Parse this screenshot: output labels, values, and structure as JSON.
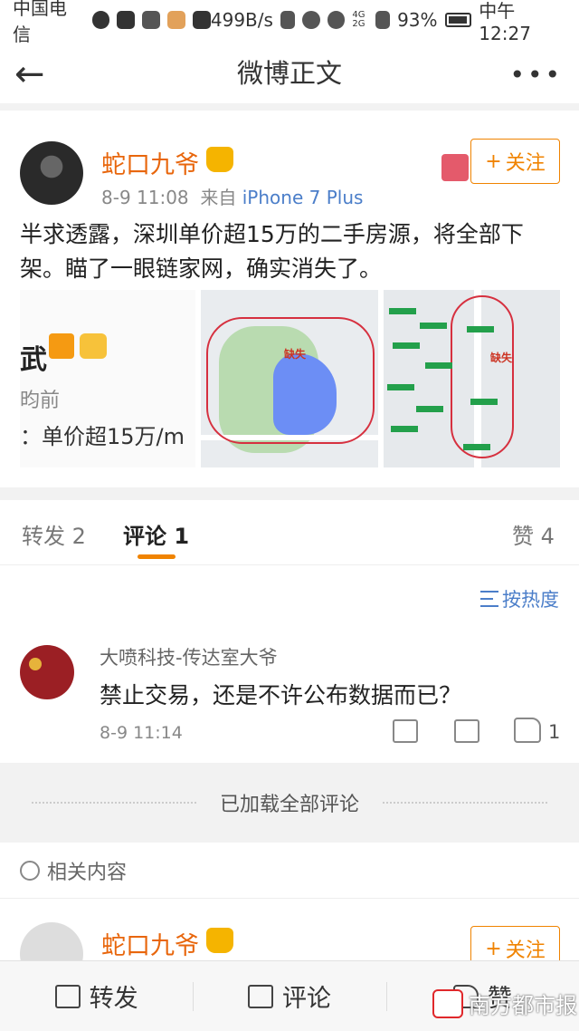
{
  "status": {
    "carrier": "中国电信",
    "speed": "499B/s",
    "signal": "4G 2G",
    "battery": "93%",
    "time": "中午12:27"
  },
  "nav": {
    "title": "微博正文",
    "back": "←",
    "more": "•••"
  },
  "post": {
    "username": "蛇口九爷",
    "time": "8-9 11:08",
    "source_prefix": "来自",
    "device": "iPhone 7 Plus",
    "follow": "关注",
    "follow_plus": "+",
    "content": "半求透露，深圳单价超15万的二手房源，将全部下架。瞄了一眼链家网，确实消失了。",
    "image1": {
      "line1": "武",
      "line2": "昀前",
      "line3": "：单价超15万/m"
    },
    "map_labels": [
      "缺失",
      "缺失"
    ]
  },
  "tabs": {
    "repost": "转发 2",
    "comment": "评论 1",
    "like": "赞 4"
  },
  "sort": "按热度",
  "comment": {
    "name": "大喷科技-传达室大爷",
    "text": "禁止交易，还是不许公布数据而已？",
    "time": "8-9 11:14",
    "likes": "1"
  },
  "loaded": "已加载全部评论",
  "related": "相关内容",
  "post2": {
    "username": "蛇口九爷",
    "follow": "关注",
    "follow_plus": "+"
  },
  "bottombar": {
    "repost": "转发",
    "comment": "评论",
    "like": "赞"
  },
  "watermark": "南方都市报",
  "colors": {
    "accent": "#f08300",
    "username": "#e8660c",
    "link": "#4b7ec9"
  }
}
